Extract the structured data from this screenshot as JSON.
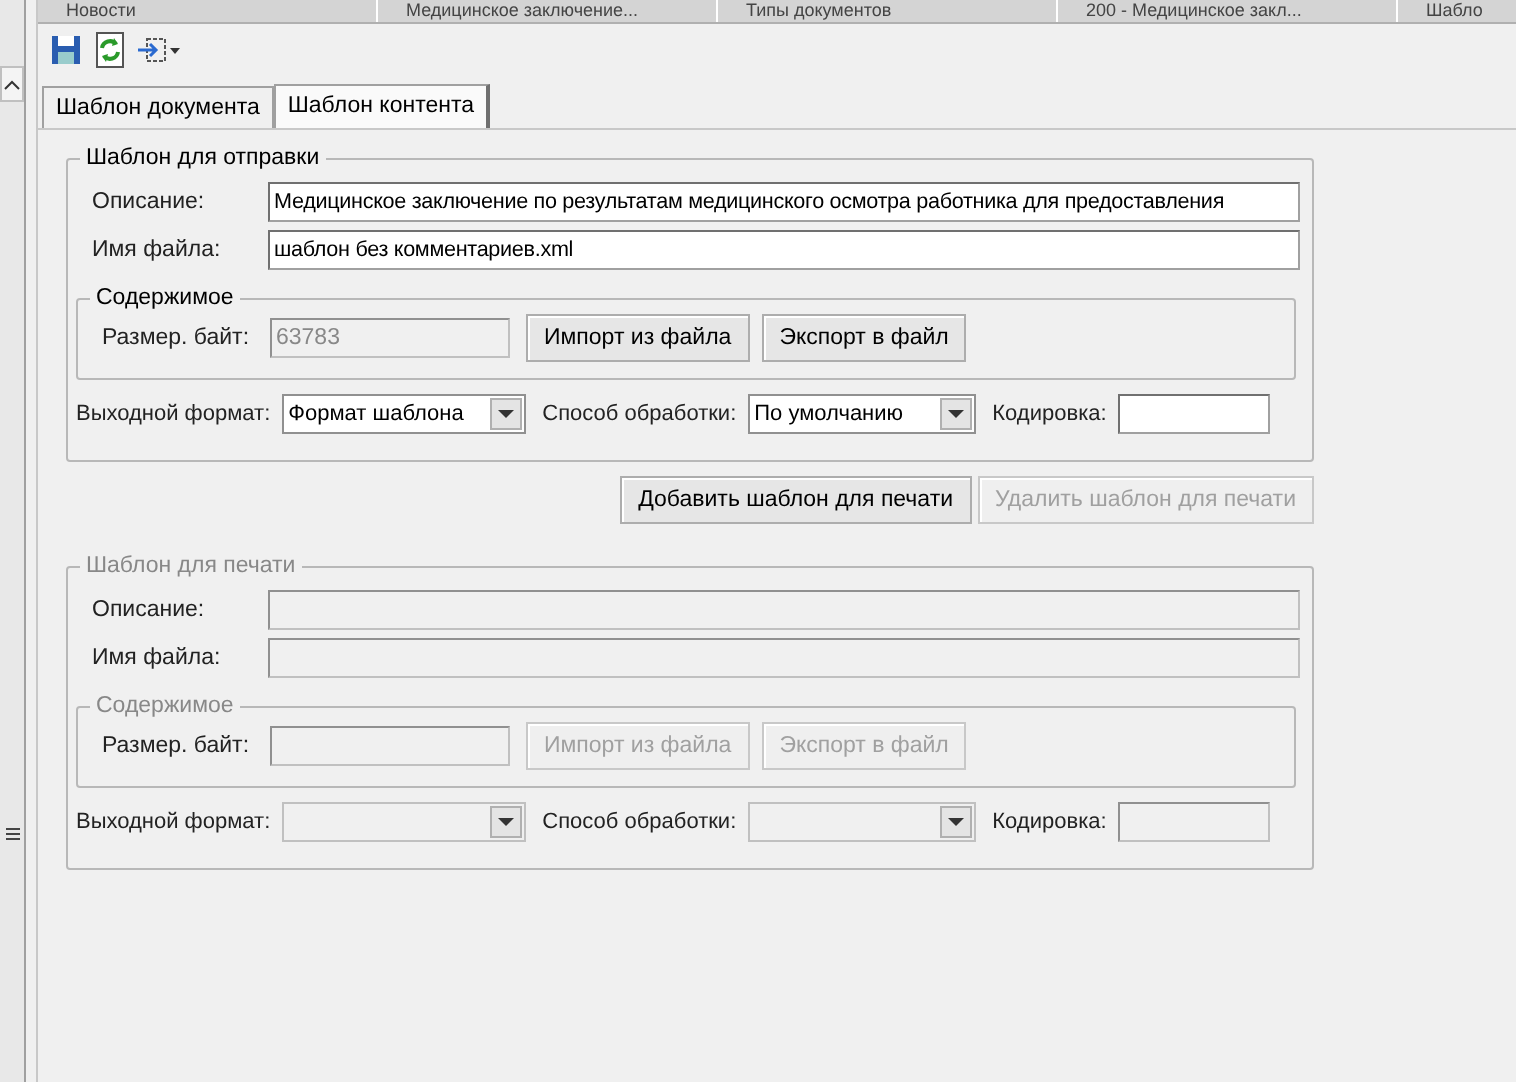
{
  "document_tabs": [
    {
      "label": "Новости",
      "selected": false
    },
    {
      "label": "Медицинское заключение...",
      "selected": false
    },
    {
      "label": "Типы документов",
      "selected": false
    },
    {
      "label": "200 - Медицинское закл...",
      "selected": false
    },
    {
      "label": "Шабло",
      "selected": false
    }
  ],
  "tabs": [
    {
      "label": "Шаблон документа",
      "selected": false
    },
    {
      "label": "Шаблон контента",
      "selected": true
    }
  ],
  "send_template": {
    "title": "Шаблон для отправки",
    "disabled": false,
    "description": {
      "label": "Описание:",
      "value": "Медицинское заключение по результатам медицинского осмотра работника для предоставления"
    },
    "file_name": {
      "label": "Имя файла:",
      "value": "шаблон без комментариев.xml"
    },
    "content": {
      "title": "Содержимое",
      "size": {
        "label": "Размер. байт:",
        "value": "63783",
        "disabled": true
      },
      "buttons": [
        "Импорт из файла",
        "Экспорт в файл"
      ]
    },
    "output_format": {
      "label": "Выходной формат:",
      "value": "Формат шаблона"
    },
    "processing": {
      "label": "Способ обработки:",
      "value": "По умолчанию"
    },
    "encoding": {
      "label": "Кодировка:"
    }
  },
  "actions": [
    {
      "label": "Добавить шаблон для печати",
      "disabled": false
    },
    {
      "label": "Удалить шаблон для печати",
      "disabled": true
    }
  ],
  "print_template": {
    "title": "Шаблон для печати",
    "disabled": true,
    "description": {
      "label": "Описание:"
    },
    "file_name": {
      "label": "Имя файла:"
    },
    "content": {
      "title": "Содержимое",
      "size": {
        "label": "Размер. байт:"
      },
      "buttons": [
        "Импорт из файла",
        "Экспорт в файл"
      ]
    },
    "output_format": {
      "label": "Выходной формат:"
    },
    "processing": {
      "label": "Способ обработки:"
    },
    "encoding": {
      "label": "Кодировка:"
    }
  }
}
